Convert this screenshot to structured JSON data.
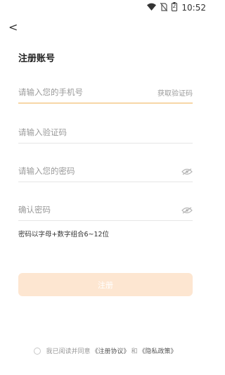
{
  "status": {
    "time": "10:52",
    "battery_level": "2"
  },
  "nav": {
    "back_label": "<"
  },
  "page": {
    "title": "注册账号"
  },
  "form": {
    "phone_placeholder": "请输入您的手机号",
    "get_code_label": "获取验证码",
    "code_placeholder": "请输入验证码",
    "password_placeholder": "请输入您的密码",
    "confirm_placeholder": "确认密码",
    "hint": "密码以字母+数字组合6~12位"
  },
  "submit_label": "注册",
  "agreement": {
    "prefix": "我已阅读并同意",
    "link1": "《注册协议》",
    "middle": "和",
    "link2": "《隐私政策》"
  },
  "colors": {
    "accent": "#f0b35a",
    "button_bg": "#fde6d1",
    "placeholder": "#9a9a9a"
  }
}
